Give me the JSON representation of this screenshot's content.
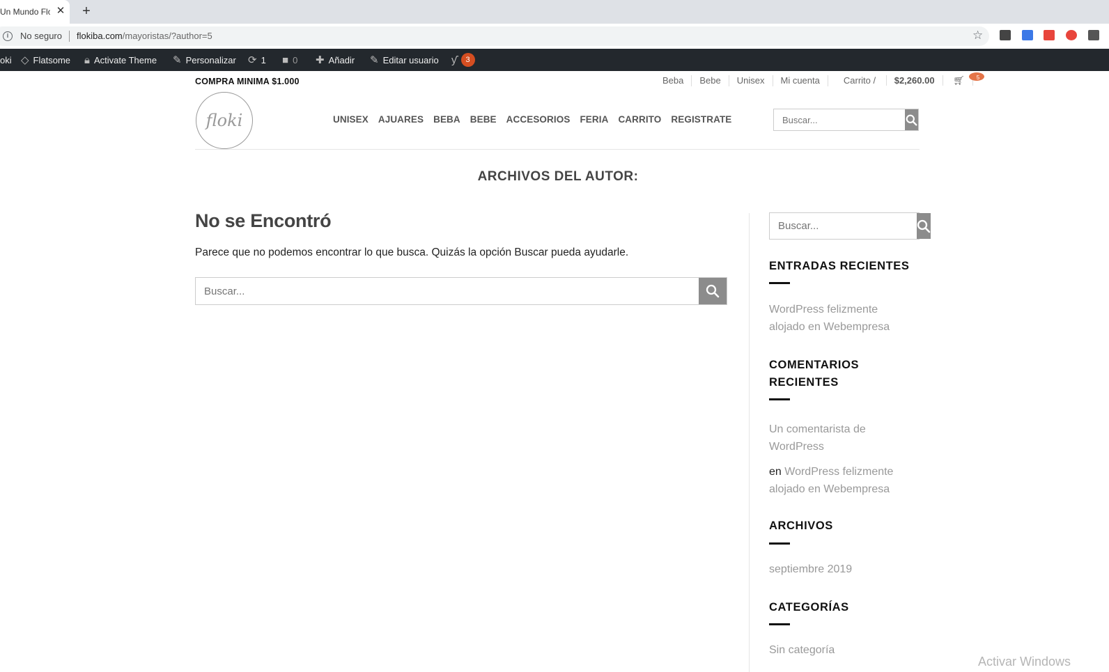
{
  "browser": {
    "tab_title": "Un Mundo Flo",
    "new_tab": "+",
    "security_label": "No seguro",
    "url_host": "flokiba.com",
    "url_path": "/mayoristas/?author=5",
    "ext_colors": [
      "#444444",
      "#3b78e7",
      "#e8453c",
      "#e8453c",
      "#555555"
    ]
  },
  "adminbar": {
    "site_name": "oki",
    "flatsome": "Flatsome",
    "activate_theme": "Activate Theme",
    "customize": "Personalizar",
    "updates_count": "1",
    "comments_count": "0",
    "add_new": "Añadir",
    "edit_user": "Editar usuario",
    "seo_badge": "3"
  },
  "header": {
    "top_left": "COMPRA MINIMA $1.000",
    "top_nav": [
      "Beba",
      "Bebe",
      "Unisex",
      "Mi cuenta"
    ],
    "cart_label": "Carrito / ",
    "cart_total": "$2,260.00",
    "cart_count": "5",
    "logo_text": "floki",
    "main_nav": [
      "UNISEX",
      "AJUARES",
      "BEBA",
      "BEBE",
      "ACCESORIOS",
      "FERIA",
      "CARRITO",
      "REGISTRATE"
    ],
    "search_placeholder": "Buscar..."
  },
  "archive_title": "ARCHIVOS DEL AUTOR:",
  "main": {
    "heading": "No se Encontró",
    "text": "Parece que no podemos encontrar lo que busca. Quizás la opción Buscar pueda ayudarle.",
    "search_placeholder": "Buscar..."
  },
  "sidebar": {
    "search_placeholder": "Buscar...",
    "recent_posts_title": "ENTRADAS RECIENTES",
    "recent_post_1": "WordPress felizmente",
    "recent_post_2": "alojado en Webempresa",
    "recent_comments_title_1": "COMENTARIOS",
    "recent_comments_title_2": "RECIENTES",
    "comment_author_1": "Un comentarista de",
    "comment_author_2": "WordPress",
    "comment_on": "en ",
    "comment_post_1": "WordPress felizmente",
    "comment_post_2": "alojado en Webempresa",
    "archives_title": "ARCHIVOS",
    "archive_1": "septiembre 2019",
    "categories_title": "CATEGORÍAS",
    "category_1": "Sin categoría"
  },
  "watermark": "Activar Windows"
}
